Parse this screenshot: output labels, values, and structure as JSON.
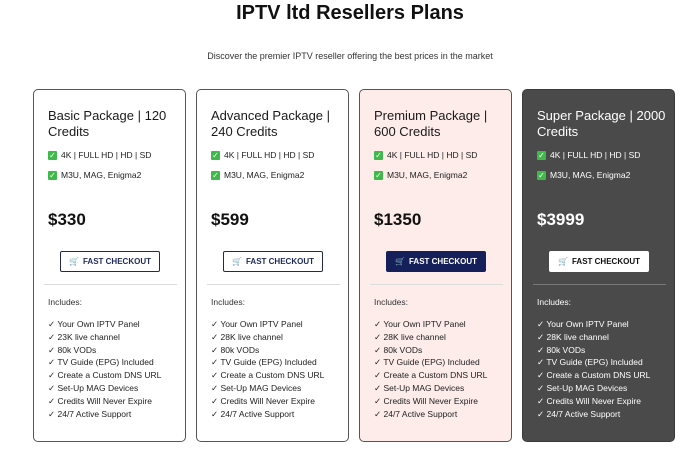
{
  "header": {
    "title": "IPTV ltd Resellers Plans",
    "subtitle": "Discover the premier IPTV reseller offering the best prices in the market"
  },
  "colors": {
    "check": "#3fba4a",
    "premium_bg": "#fdecea",
    "super_bg": "#4a4a4a",
    "primary_button": "#15205a"
  },
  "plans": [
    {
      "title": "Basic Package | 120 Credits",
      "features": [
        "4K | FULL HD | HD | SD",
        "M3U, MAG, Enigma2"
      ],
      "price": "$330",
      "button": "FAST CHECKOUT",
      "includes_label": "Includes:",
      "includes": [
        "✓ Your Own IPTV Panel",
        "✓ 23K live channel",
        "✓ 80k VODs",
        "✓ TV Guide (EPG) Included",
        "✓ Create a Custom DNS URL",
        "✓ Set-Up MAG Devices",
        "✓ Credits Will Never Expire",
        "✓ 24/7 Active Support"
      ]
    },
    {
      "title": "Advanced Package | 240 Credits",
      "features": [
        "4K | FULL HD | HD | SD",
        "M3U, MAG, Enigma2"
      ],
      "price": "$599",
      "button": "FAST CHECKOUT",
      "includes_label": "Includes:",
      "includes": [
        "✓ Your Own IPTV Panel",
        "✓ 28K live channel",
        "✓ 80k VODs",
        "✓ TV Guide (EPG) Included",
        "✓ Create a Custom DNS URL",
        "✓ Set-Up MAG Devices",
        "✓ Credits Will Never Expire",
        "✓ 24/7 Active Support"
      ]
    },
    {
      "title": "Premium Package | 600 Credits",
      "features": [
        "4K | FULL HD | HD | SD",
        "M3U, MAG, Enigma2"
      ],
      "price": "$1350",
      "button": "FAST CHECKOUT",
      "includes_label": "Includes:",
      "includes": [
        "✓ Your Own IPTV Panel",
        "✓ 28K live channel",
        "✓ 80k VODs",
        "✓ TV Guide (EPG) Included",
        "✓ Create a Custom DNS URL",
        "✓ Set-Up MAG Devices",
        "✓ Credits Will Never Expire",
        "✓ 24/7 Active Support"
      ]
    },
    {
      "title": "Super Package | 2000 Credits",
      "features": [
        "4K | FULL HD | HD | SD",
        "M3U, MAG, Enigma2"
      ],
      "price": "$3999",
      "button": "FAST CHECKOUT",
      "includes_label": "Includes:",
      "includes": [
        "✓ Your Own IPTV Panel",
        "✓ 28K live channel",
        "✓ 80k VODs",
        "✓ TV Guide (EPG) Included",
        "✓ Create a Custom DNS URL",
        "✓ Set-Up MAG Devices",
        "✓ Credits Will Never Expire",
        "✓ 24/7 Active Support"
      ]
    }
  ]
}
